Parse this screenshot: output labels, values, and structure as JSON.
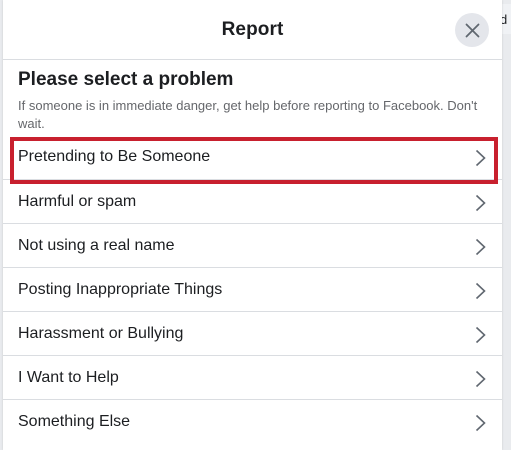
{
  "background_tab": {
    "label": "Find"
  },
  "dialog": {
    "title": "Report",
    "close_icon": "close-icon"
  },
  "section": {
    "title": "Please select a problem",
    "subtitle": "If someone is in immediate danger, get help before reporting to Facebook. Don't wait."
  },
  "options": [
    {
      "label": "Pretending to Be Someone",
      "highlighted": true
    },
    {
      "label": "Harmful or spam",
      "highlighted": false
    },
    {
      "label": "Not using a real name",
      "highlighted": false
    },
    {
      "label": "Posting Inappropriate Things",
      "highlighted": false
    },
    {
      "label": "Harassment or Bullying",
      "highlighted": false
    },
    {
      "label": "I Want to Help",
      "highlighted": false
    },
    {
      "label": "Something Else",
      "highlighted": false
    }
  ],
  "colors": {
    "highlight_border": "#c8202e",
    "text_primary": "#1c1e21",
    "text_secondary": "#65676b",
    "divider": "#dadde1"
  }
}
